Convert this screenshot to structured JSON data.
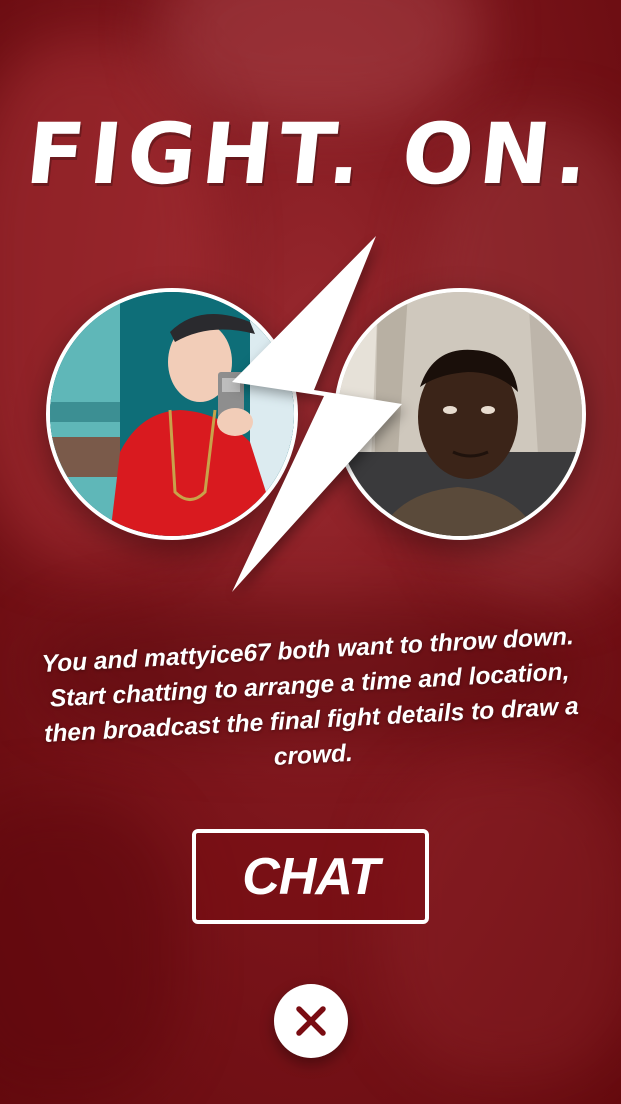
{
  "headline": "FIGHT. ON.",
  "match": {
    "left_profile": "user-photo",
    "right_profile": "mattyice67-photo",
    "divider_icon": "lightning-bolt-icon"
  },
  "message": "You and mattyice67 both want to throw down. Start chatting to arrange a time and location, then broadcast the final fight details to draw a crowd.",
  "actions": {
    "chat_label": "CHAT",
    "close_icon": "close-icon"
  },
  "colors": {
    "background": "#7c151b",
    "accent": "#ffffff"
  }
}
